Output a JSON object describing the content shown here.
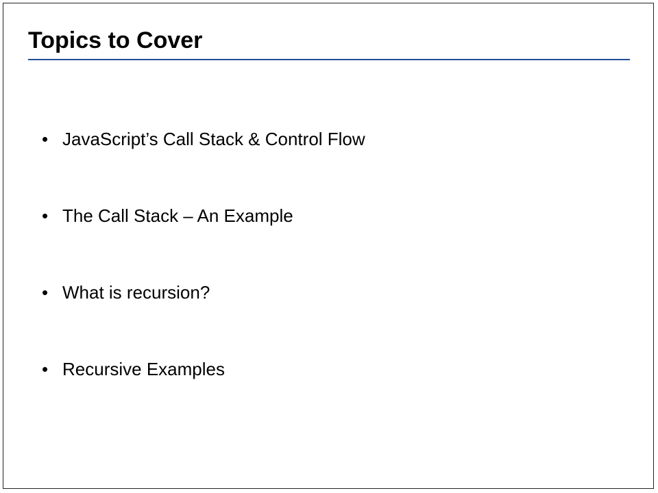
{
  "slide": {
    "title": "Topics to Cover",
    "accent_color": "#1f4e96",
    "bullet_symbol": "•",
    "bullets": [
      {
        "text": "JavaScript’s Call Stack & Control Flow"
      },
      {
        "text": "The Call Stack – An Example"
      },
      {
        "text": "What is recursion?"
      },
      {
        "text": "Recursive Examples"
      }
    ]
  }
}
